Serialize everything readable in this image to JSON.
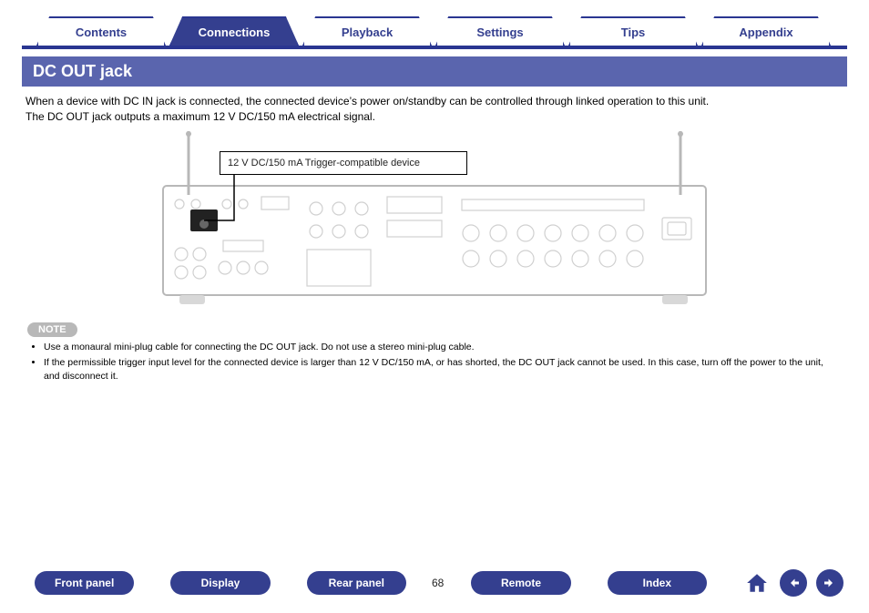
{
  "tabs": [
    {
      "label": "Contents",
      "active": false
    },
    {
      "label": "Connections",
      "active": true
    },
    {
      "label": "Playback",
      "active": false
    },
    {
      "label": "Settings",
      "active": false
    },
    {
      "label": "Tips",
      "active": false
    },
    {
      "label": "Appendix",
      "active": false
    }
  ],
  "section_title": "DC OUT jack",
  "intro_line1": "When a device with DC IN jack is connected, the connected device’s power on/standby can be controlled through linked operation to this unit.",
  "intro_line2": "The DC OUT jack outputs a maximum 12 V DC/150 mA electrical signal.",
  "callout": "12 V DC/150 mA Trigger-compatible device",
  "note_label": "NOTE",
  "notes": [
    "Use a monaural mini-plug cable for connecting the DC OUT jack. Do not use a stereo mini-plug cable.",
    "If the permissible trigger input level for the connected device is larger than 12 V DC/150 mA, or has shorted, the DC OUT jack cannot be used. In this case, turn off the power to the unit, and disconnect it."
  ],
  "bottom_nav": {
    "front_panel": "Front panel",
    "display": "Display",
    "rear_panel": "Rear panel",
    "remote": "Remote",
    "index": "Index"
  },
  "page_number": "68",
  "icons": {
    "home": "home-icon",
    "prev": "arrow-left-icon",
    "next": "arrow-right-icon"
  }
}
